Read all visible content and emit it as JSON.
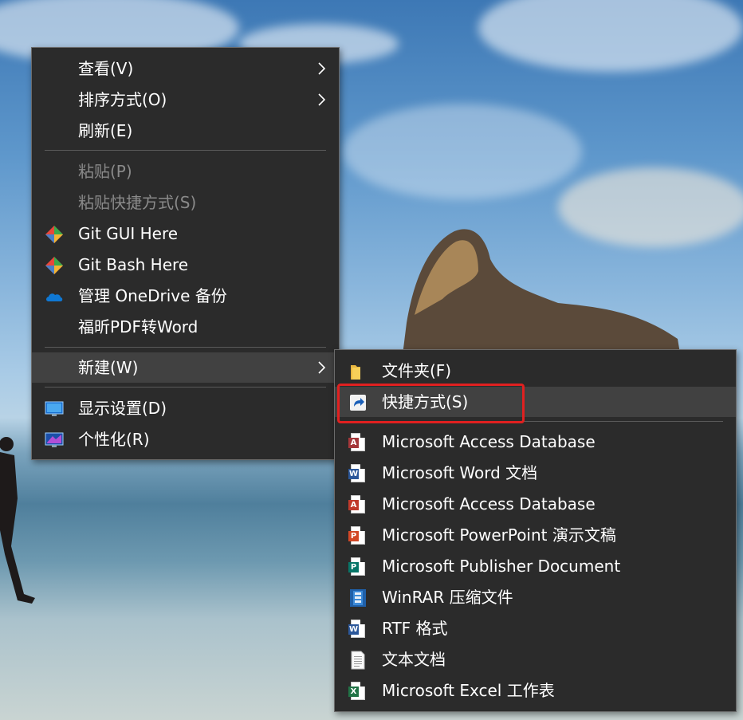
{
  "main_menu": {
    "items": [
      {
        "label": "查看(V)",
        "has_submenu": true
      },
      {
        "label": "排序方式(O)",
        "has_submenu": true
      },
      {
        "label": "刷新(E)"
      },
      {
        "label": "粘贴(P)",
        "disabled": true
      },
      {
        "label": "粘贴快捷方式(S)",
        "disabled": true
      },
      {
        "label": "Git GUI Here",
        "icon": "git-gui-icon"
      },
      {
        "label": "Git Bash Here",
        "icon": "git-bash-icon"
      },
      {
        "label": "管理 OneDrive 备份",
        "icon": "onedrive-icon"
      },
      {
        "label": "福昕PDF转Word"
      },
      {
        "label": "新建(W)",
        "has_submenu": true,
        "active": true
      },
      {
        "label": "显示设置(D)",
        "icon": "display-settings-icon"
      },
      {
        "label": "个性化(R)",
        "icon": "personalize-icon"
      }
    ]
  },
  "new_submenu": {
    "items": [
      {
        "label": "文件夹(F)",
        "icon": "folder-icon"
      },
      {
        "label": "快捷方式(S)",
        "icon": "shortcut-icon",
        "highlighted": true
      },
      {
        "label": "Microsoft Access Database",
        "icon": "access-icon"
      },
      {
        "label": "Microsoft Word 文档",
        "icon": "word-icon"
      },
      {
        "label": "Microsoft Access Database",
        "icon": "access-icon"
      },
      {
        "label": "Microsoft PowerPoint 演示文稿",
        "icon": "powerpoint-icon"
      },
      {
        "label": "Microsoft Publisher Document",
        "icon": "publisher-icon"
      },
      {
        "label": "WinRAR 压缩文件",
        "icon": "winrar-icon"
      },
      {
        "label": "RTF 格式",
        "icon": "rtf-icon"
      },
      {
        "label": "文本文档",
        "icon": "text-document-icon"
      },
      {
        "label": "Microsoft Excel 工作表",
        "icon": "excel-icon"
      }
    ]
  },
  "colors": {
    "menu_background": "#2b2b2b",
    "menu_hover": "#414141",
    "highlight_border": "#e02020",
    "access": "#a4373a",
    "word": "#2b579a",
    "powerpoint": "#d24726",
    "publisher": "#077568",
    "excel": "#217346"
  }
}
